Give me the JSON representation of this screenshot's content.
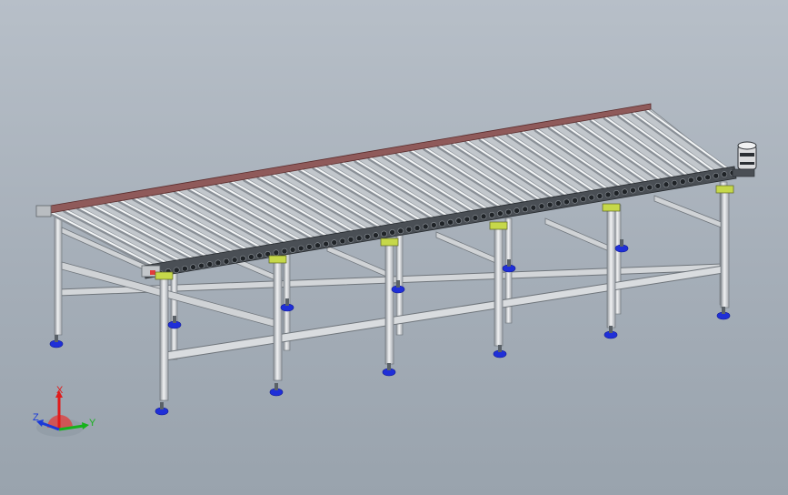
{
  "viewport": {
    "background_top": "#b7bfc8",
    "background_bottom": "#99a3ad",
    "model": "roller-conveyor",
    "colors": {
      "frame": "#c9ccd0",
      "frame_shadow": "#7d8288",
      "roller": "#e6e9ec",
      "side_rail_trim": "#7a2b2b",
      "foot": "#1f2fd8",
      "bracket": "#c6d84a",
      "chain": "#2b2f34",
      "motor": "#d9dadc"
    }
  },
  "triad": {
    "x_label": "X",
    "y_label": "Y",
    "z_label": "Z",
    "x_color": "#e01b1b",
    "y_color": "#16b21b",
    "z_color": "#1a3ad8"
  }
}
